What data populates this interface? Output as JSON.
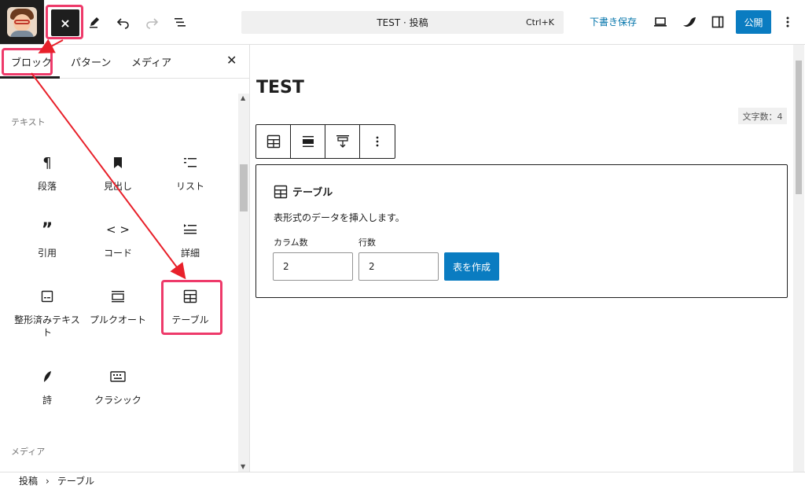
{
  "toolbar": {
    "close_inserter_glyph": "×",
    "command_title": "TEST · 投稿",
    "command_shortcut": "Ctrl+K",
    "save_draft": "下書き保存",
    "publish": "公開"
  },
  "inserter": {
    "tabs": [
      "ブロック",
      "パターン",
      "メディア"
    ],
    "active_tab": "ブロック",
    "category_text": "テキスト",
    "category_media": "メディア",
    "blocks": [
      {
        "label": "段落",
        "icon": "paragraph-icon"
      },
      {
        "label": "見出し",
        "icon": "bookmark-icon"
      },
      {
        "label": "リスト",
        "icon": "list-icon"
      },
      {
        "label": "引用",
        "icon": "quote-icon"
      },
      {
        "label": "コード",
        "icon": "code-icon"
      },
      {
        "label": "詳細",
        "icon": "details-icon"
      },
      {
        "label": "整形済みテキスト",
        "icon": "preformatted-icon"
      },
      {
        "label": "プルクオート",
        "icon": "pullquote-icon"
      },
      {
        "label": "テーブル",
        "icon": "table-icon"
      },
      {
        "label": "詩",
        "icon": "verse-icon"
      },
      {
        "label": "クラシック",
        "icon": "keyboard-icon"
      }
    ]
  },
  "editor": {
    "post_title": "TEST",
    "char_count": "文字数：4",
    "placeholder": {
      "label": "テーブル",
      "instructions": "表形式のデータを挿入します。",
      "columns_label": "カラム数",
      "rows_label": "行数",
      "columns_value": "2",
      "rows_value": "2",
      "create_button": "表を作成"
    }
  },
  "footer": {
    "breadcrumb": [
      "投稿",
      "テーブル"
    ],
    "separator": "›"
  },
  "colors": {
    "accent": "#0a7cc1",
    "highlight": "#ee3a6a",
    "annotation_arrow": "#e8202a"
  }
}
